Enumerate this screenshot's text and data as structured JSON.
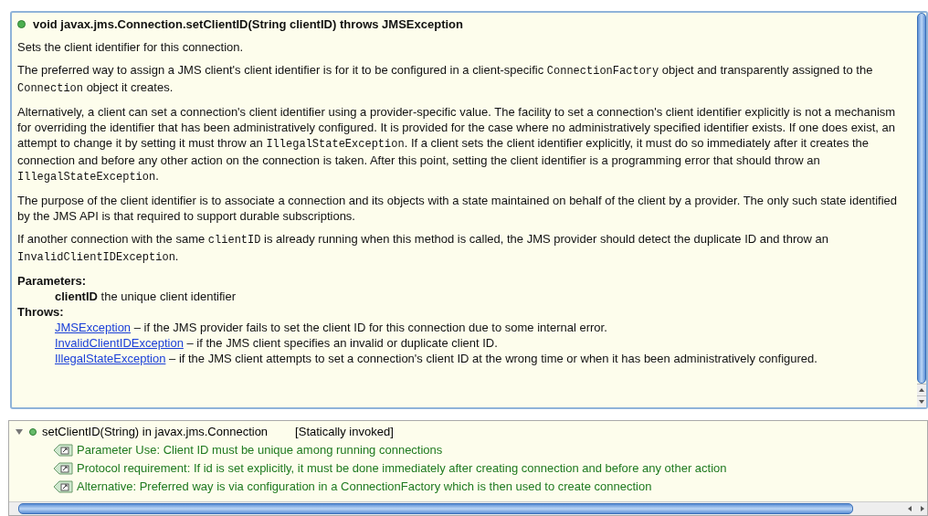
{
  "doc": {
    "signature": "void javax.jms.Connection.setClientID(String clientID) throws JMSException",
    "paragraphs": [
      [
        {
          "t": "Sets the client identifier for this connection."
        }
      ],
      [
        {
          "t": "The preferred way to assign a JMS client's client identifier is for it to be configured in a client-specific "
        },
        {
          "t": "ConnectionFactory",
          "code": true
        },
        {
          "t": " object and transparently assigned to the "
        },
        {
          "t": "Connection",
          "code": true
        },
        {
          "t": " object it creates."
        }
      ],
      [
        {
          "t": "Alternatively, a client can set a connection's client identifier using a provider-specific value. The facility to set a connection's client identifier explicitly is not a mechanism for overriding the identifier that has been administratively configured. It is provided for the case where no administratively specified identifier exists. If one does exist, an attempt to change it by setting it must throw an "
        },
        {
          "t": "IllegalStateException",
          "code": true
        },
        {
          "t": ". If a client sets the client identifier explicitly, it must do so immediately after it creates the connection and before any other action on the connection is taken. After this point, setting the client identifier is a programming error that should throw an "
        },
        {
          "t": "IllegalStateException",
          "code": true
        },
        {
          "t": "."
        }
      ],
      [
        {
          "t": "The purpose of the client identifier is to associate a connection and its objects with a state maintained on behalf of the client by a provider. The only such state identified by the JMS API is that required to support durable subscriptions."
        }
      ],
      [
        {
          "t": "If another connection with the same "
        },
        {
          "t": "clientID",
          "code": true
        },
        {
          "t": " is already running when this method is called, the JMS provider should detect the duplicate ID and throw an "
        },
        {
          "t": "InvalidClientIDException",
          "code": true
        },
        {
          "t": "."
        }
      ]
    ],
    "parameters_label": "Parameters:",
    "parameters": [
      {
        "name": "clientID",
        "desc": "the unique client identifier"
      }
    ],
    "throws_label": "Throws:",
    "throws": [
      {
        "link": "JMSException",
        "desc": "– if the JMS provider fails to set the client ID for this connection due to some internal error."
      },
      {
        "link": "InvalidClientIDException",
        "desc": "– if the JMS client specifies an invalid or duplicate client ID."
      },
      {
        "link": "IllegalStateException",
        "desc": "– if the JMS client attempts to set a connection's client ID at the wrong time or when it has been administratively configured."
      }
    ]
  },
  "tree": {
    "expanded": true,
    "label": "setClientID(String) in javax.jms.Connection",
    "note": "[Statically invoked]",
    "children": [
      {
        "label": "Parameter Use: Client ID must be unique among running connections"
      },
      {
        "label": "Protocol requirement: If id is set explicitly, it must be done immediately after creating connection and before any other action"
      },
      {
        "label": "Alternative: Preferred way is via configuration in a ConnectionFactory which is then used to create connection"
      }
    ]
  }
}
